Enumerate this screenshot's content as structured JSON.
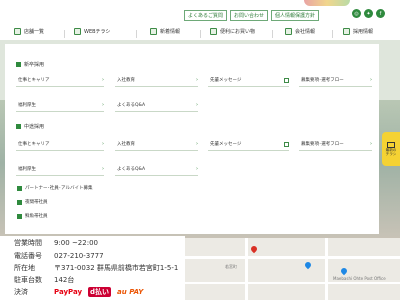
{
  "header": {
    "top_links": [
      "よくあるご質問",
      "お問い合わせ",
      "個人情報保護方針"
    ],
    "sns": [
      "instagram-icon",
      "twitter-icon",
      "facebook-icon"
    ]
  },
  "nav": {
    "items": [
      "店舗一覧",
      "WEBチラシ",
      "新着情報",
      "便利にお買い物",
      "会社情報",
      "採用情報"
    ]
  },
  "menu": {
    "new_grad": {
      "title": "新卒採用",
      "items": [
        "仕事とキャリア",
        "入社教育",
        "先輩メッセージ",
        "募集要項･選考フロー",
        "福利厚生",
        "よくあるQ&A"
      ]
    },
    "mid_career": {
      "title": "中途採用",
      "items": [
        "仕事とキャリア",
        "入社教育",
        "先輩メッセージ",
        "募集要項･選考フロー",
        "福利厚生",
        "よくあるQ&A"
      ]
    },
    "links": [
      "パートナー･社員･アルバイト募集",
      "夜間帯社員",
      "鮮魚帯社員"
    ]
  },
  "flyer_tab": {
    "line1": "最新の",
    "line2": "チラシ"
  },
  "store_info": {
    "rows": [
      {
        "key": "営業時間",
        "value": "9:00 ~22:00"
      },
      {
        "key": "電話番号",
        "value": "027-210-3777"
      },
      {
        "key": "所在地",
        "value": "〒371-0032 群馬県前橋市若宮町1-5-1"
      },
      {
        "key": "駐車台数",
        "value": "142台"
      },
      {
        "key": "決済",
        "value": ""
      }
    ],
    "payments": [
      "PayPay",
      "d払い",
      "au PAY"
    ]
  },
  "map": {
    "labels": [
      "Maebashi Ohte Post Office",
      "若宮町"
    ]
  },
  "colors": {
    "brand_green": "#2f8a3e",
    "flyer_yellow": "#f5d233"
  }
}
